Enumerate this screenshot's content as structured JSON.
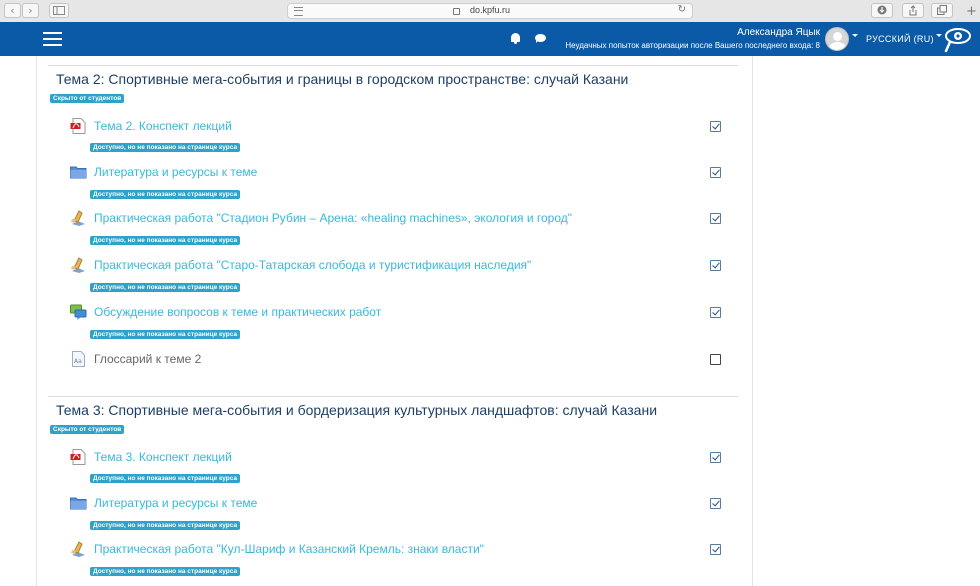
{
  "browser": {
    "url": "do.kpfu.ru",
    "back_glyph": "‹",
    "forward_glyph": "›"
  },
  "navbar": {
    "user_name": "Александра Яцык",
    "failed_logins": "Неудачных попыток авторизации после Вашего последнего входа: 8",
    "language": "РУССКИЙ (RU)",
    "bg_color": "#0a5aa8"
  },
  "sections": [
    {
      "title": "Тема 2: Спортивные мега-события и границы в городском пространстве: случай Казани",
      "hidden_badge": "Скрыто от студентов",
      "activities": [
        {
          "icon": "pdf-icon",
          "label": "Тема 2. Конспект лекций",
          "badge": "Доступно, но не показано на странице курса",
          "completed": true
        },
        {
          "icon": "folder-icon",
          "label": "Литература и ресурсы к теме",
          "badge": "Доступно, но не показано на странице курса",
          "completed": true
        },
        {
          "icon": "assignment-icon",
          "label": "Практическая работа \"Стадион Рубин – Арена: «healing machines», экология и город\"",
          "badge": "Доступно, но не показано на странице курса",
          "completed": true
        },
        {
          "icon": "assignment-icon",
          "label": "Практическая работа \"Старо-Татарская слобода и туристификация наследия\"",
          "badge": "Доступно, но не показано на странице курса",
          "completed": true
        },
        {
          "icon": "forum-icon",
          "label": "Обсуждение вопросов к теме и практических работ",
          "badge": "Доступно, но не показано на странице курса",
          "completed": true
        },
        {
          "icon": "glossary-icon",
          "label": "Глоссарий к теме 2",
          "badge": "",
          "completed": false
        }
      ]
    },
    {
      "title": "Тема 3: Спортивные мега-события и бордеризация культурных ландшафтов: случай Казани",
      "hidden_badge": "Скрыто от студентов",
      "activities": [
        {
          "icon": "pdf-icon",
          "label": "Тема 3. Конспект лекций",
          "badge": "Доступно, но не показано на странице курса",
          "completed": true
        },
        {
          "icon": "folder-icon",
          "label": "Литература и ресурсы к теме",
          "badge": "Доступно, но не показано на странице курса",
          "completed": true
        },
        {
          "icon": "assignment-icon",
          "label": "Практическая работа \"Кул-Шариф и Казанский Кремль: знаки власти\"",
          "badge": "Доступно, но не показано на странице курса",
          "completed": true
        }
      ]
    }
  ]
}
